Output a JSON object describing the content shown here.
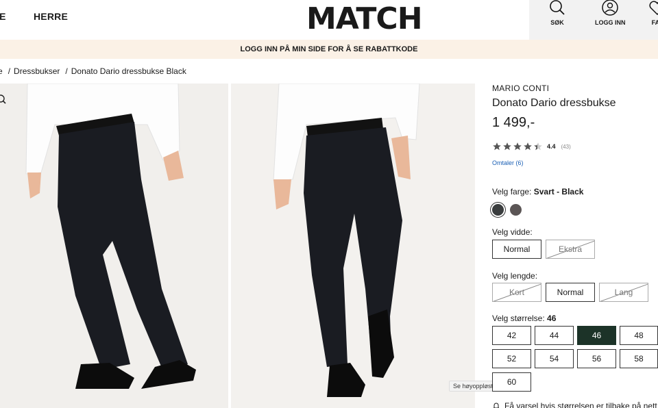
{
  "header": {
    "nav": [
      "IE",
      "HERRE"
    ],
    "logo": "MATCH",
    "tools": [
      {
        "label": "SØK",
        "icon": "search-icon"
      },
      {
        "label": "LOGG INN",
        "icon": "user-icon"
      },
      {
        "label": "FAV",
        "icon": "heart-icon"
      }
    ]
  },
  "promo": "LOGG INN PÅ MIN SIDE FOR Å SE RABATTKODE",
  "breadcrumb": [
    "e",
    "Dressbukser",
    "Donato Dario dressbukse Black"
  ],
  "gallery": {
    "tooltip": "Se høyoppløste bilder"
  },
  "product": {
    "brand": "MARIO CONTI",
    "title": "Donato Dario dressbukse",
    "price": "1 499,-",
    "rating": 4.4,
    "rating_value": "4.4",
    "rating_count": "(43)",
    "reviews": "Omtaler (6)",
    "color_label": "Velg farge:",
    "color_value": "Svart - Black",
    "colors": [
      "#3a3d3e",
      "#5b5555"
    ],
    "width_label": "Velg vidde:",
    "widths": [
      "Normal",
      "Ekstra"
    ],
    "length_label": "Velg lengde:",
    "lengths": [
      "Kort",
      "Normal",
      "Lang"
    ],
    "size_label": "Velg størrelse:",
    "size_value": "46",
    "sizes": [
      "42",
      "44",
      "46",
      "48",
      "52",
      "54",
      "56",
      "58",
      "60"
    ],
    "notice": "Få varsel hvis størrelsen er tilbake på nett"
  },
  "colors": {
    "accent": "#1c3328",
    "promo_bg": "#fbf1e6",
    "link": "#1a5fb4"
  }
}
